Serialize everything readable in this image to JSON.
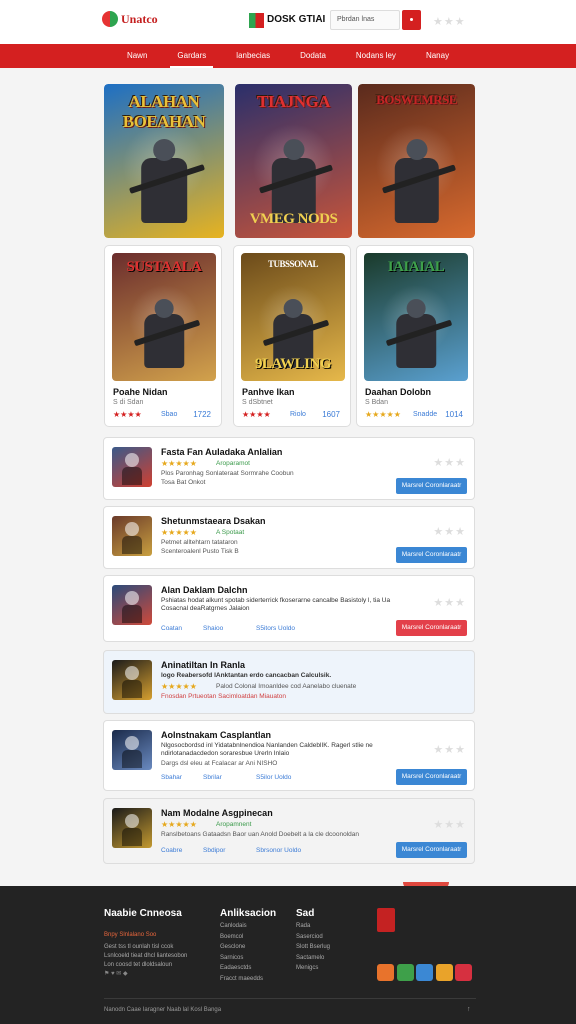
{
  "header": {
    "logo_text": "Unatco",
    "brand_text": "DOSK GTIAI",
    "search_placeholder": "Pbrdan lnas",
    "rating_stars": "★★★"
  },
  "nav": {
    "items": [
      "Nawn",
      "Gardars",
      "lanbecias",
      "Dodata",
      "Nodans ley",
      "Nanay"
    ],
    "active_index": 1
  },
  "posters": [
    {
      "title": "ALAHAN BOEAHAN",
      "colors": [
        "#1d6fc4",
        "#e7b320"
      ]
    },
    {
      "title": "TIAJNGA",
      "subtitle": "VMEG NODS",
      "colors": [
        "#2a2f6b",
        "#c8553a"
      ]
    },
    {
      "title": "BOSWEMRSE",
      "colors": [
        "#5a2a1d",
        "#d86a2e"
      ]
    }
  ],
  "games": [
    {
      "poster_title": "SUSTAALA",
      "title": "Poahe Nidan",
      "subtitle": "S di Sdan",
      "stars": "★★★★",
      "meta": "Sbao",
      "score": "1722",
      "colors": [
        "#6b2d2d",
        "#d2a24c"
      ]
    },
    {
      "poster_title": "9LAWLING",
      "poster_top": "TUBSSONAL",
      "title": "Panhve Ikan",
      "subtitle": "S dSbtnet",
      "stars": "★★★★",
      "meta": "Riolo",
      "score": "1607",
      "colors": [
        "#6b4a1a",
        "#e6b84a"
      ]
    },
    {
      "poster_title": "IAIAIAL",
      "title": "Daahan Dolobn",
      "subtitle": "S Bdan",
      "stars": "★★★★★",
      "meta": "Snadde",
      "score": "1014",
      "colors": [
        "#1a3a2a",
        "#5aa0d0"
      ]
    }
  ],
  "list": [
    {
      "title": "Fasta Fan Auladaka Anlalian",
      "stars": "★★★★★",
      "tag": "Aroparamot",
      "sub": "Plos Paronhag  Sonlateraat Sormrahe Coobun",
      "sub2": "Tosa Bat Onkot",
      "button": "Marsrel Coronlaraatr",
      "btn_color": "blue",
      "side": "★★★"
    },
    {
      "title": "Shetunmstaeara Dsakan",
      "stars": "★★★★★",
      "tag": "A Spotaat",
      "sub": "Petmet alltehtarn tatataron",
      "sub2": "Scenteroalenl Pusto Tisk B",
      "button": "Marsrel Coronlaraatr",
      "btn_color": "blue",
      "side": "★★★"
    },
    {
      "title": "Alan Daklam Dalchn",
      "text": "Pshiatas hodat alkunt spotab siderterrick fkoserarne cancalbe Basistoly l, tia Ua Cosacnal  deaRatgrnes Jalaion",
      "meta1": "Coatan",
      "meta2": "Shaioo",
      "meta3": "S5itors Uoldo",
      "button": "Marsrel Coronlaraatr",
      "btn_color": "red",
      "side": "★★★"
    },
    {
      "title": "Aninatiltan In Ranla",
      "text": "logo Reabersofd lAnktantan erdo cancacban Calculsik.",
      "stars": "★★★★★",
      "sub": "Palod Colonal Imoanldee cod Aanelabo cluenate",
      "sub2": "Fnosdan Prtueotan Sacimloatdan Miauaton",
      "highlight": true
    },
    {
      "title": "Aolnstnakam Casplantlan",
      "text": "Nlgosocbordsd inl Yidatabnlnendioa Nanlanden CaldeblIK. Ragerl stlie ne ndirlotanadacdedon soraresbue Urerln Inlaio",
      "sub": "Dargs dsl eleu at Fcalacar ar Ani NISHO",
      "meta1": "Sbahar",
      "meta2": "Sbrilar",
      "meta3": "S5ilor Uoldo",
      "button": "Marsrel Coronlaraatr",
      "btn_color": "blue",
      "side": "★★★"
    },
    {
      "title": "Nam Modalne Asgpinecan",
      "stars": "★★★★★",
      "tag": "Aropamnent",
      "sub": "Ranslbetoans Gataadsn Baor uan  Anold Doebelt a la cle dcoonoldan",
      "meta1": "Coabre",
      "meta2": "Sbdipor",
      "meta3": "Sbrsonor Uoldo",
      "button": "Marsrel Coronlaraatr",
      "btn_color": "blue",
      "side": "★★★",
      "grey": true
    }
  ],
  "footer": {
    "col1": {
      "heading": "Naabie Cnneosa",
      "link_orange": "Bnpy Slnlalano Soo",
      "lines": [
        "Gest tss tl ounlah tisl ccok",
        "Lsnlcoeld tieat dhcl liantesobon",
        "Lon coosd tet dloldsaloun"
      ]
    },
    "col2": {
      "heading": "Anliksacion",
      "links": [
        "Canlodais",
        "Boemcol",
        "Gesclone",
        "Sarnicos",
        "Eadaesctds",
        "Fracct maeedds"
      ]
    },
    "col3": {
      "heading": "Sad",
      "links": [
        "Rada",
        "Saserciod",
        "Slott Bserlug",
        "Sactamelo",
        "Menigcs"
      ]
    },
    "copyright": "Nanodn Caae Iaragner Naab lal Kosl Banga",
    "social_colors": [
      "#e8732c",
      "#3ea04a",
      "#3b88d4",
      "#e9a32a",
      "#d63040"
    ]
  }
}
